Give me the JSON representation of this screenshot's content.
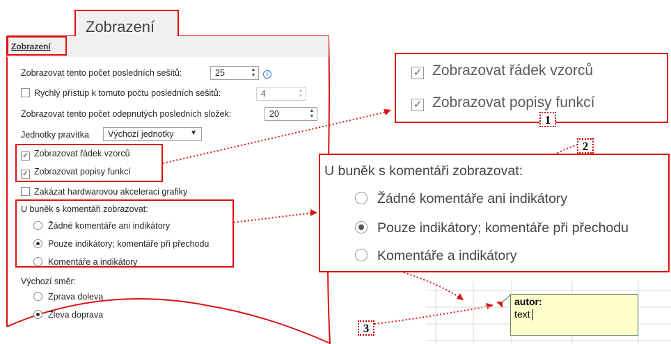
{
  "section_title": "Zobrazení",
  "panel_header": "Zobrazení",
  "settings": {
    "recent_workbooks_label": "Zobrazovat tento počet posledních sešitů:",
    "recent_workbooks_value": "25",
    "quick_access_label": "Rychlý přístup k tomuto počtu posledních sešitů:",
    "quick_access_checked": false,
    "quick_access_value": "4",
    "recent_folders_label": "Zobrazovat tento počet odepnutých posledních složek:",
    "recent_folders_value": "20",
    "ruler_units_label": "Jednotky pravítka",
    "ruler_units_value": "Výchozí jednotky",
    "show_formula_bar_label": "Zobrazovat řádek vzorců",
    "show_formula_bar_checked": true,
    "show_function_tooltips_label": "Zobrazovat popisy funkcí",
    "show_function_tooltips_checked": true,
    "disable_hw_accel_label": "Zakázat hardwarovou akceleraci grafiky",
    "disable_hw_accel_checked": false,
    "comments_group_label": "U buněk s komentáři zobrazovat:",
    "comments_options": [
      {
        "label": "Žádné komentáře ani indikátory",
        "selected": false
      },
      {
        "label": "Pouze indikátory; komentáře při přechodu",
        "selected": true
      },
      {
        "label": "Komentáře a indikátory",
        "selected": false
      }
    ],
    "direction_group_label": "Výchozí směr:",
    "direction_options": [
      {
        "label": "Zprava doleva",
        "selected": false
      },
      {
        "label": "Zleva doprava",
        "selected": true
      }
    ]
  },
  "zoom_formula": {
    "formula_bar_label": "Zobrazovat řádek vzorců",
    "function_tooltips_label": "Zobrazovat popisy funkcí"
  },
  "zoom_comments": {
    "group_label": "U buněk s komentáři zobrazovat:",
    "options": [
      {
        "label": "Žádné komentáře ani indikátory",
        "selected": false
      },
      {
        "label": "Pouze indikátory; komentáře při přechodu",
        "selected": true
      },
      {
        "label": "Komentáře a indikátory",
        "selected": false
      }
    ]
  },
  "badges": [
    "1",
    "2",
    "3"
  ],
  "comment": {
    "author": "autor:",
    "text": "text"
  },
  "colors": {
    "accent_red": "#dd1111",
    "comment_fill": "#ffffcc",
    "comment_indicator": "#d11"
  }
}
